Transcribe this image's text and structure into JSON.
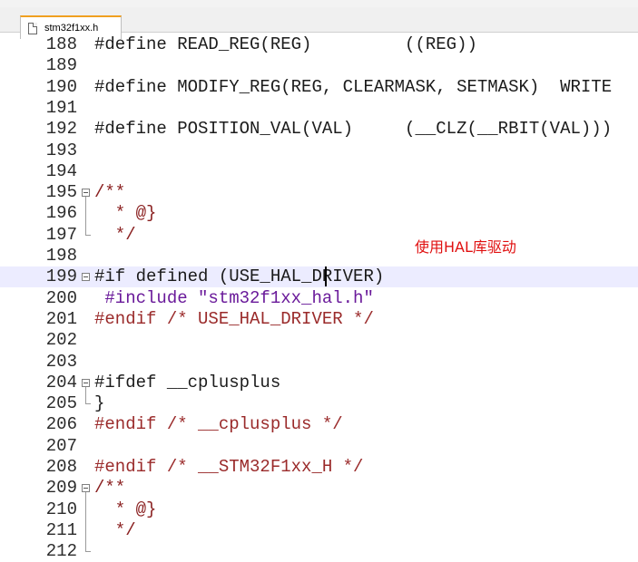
{
  "tab": {
    "filename": "stm32f1xx.h"
  },
  "annotation": "使用HAL库驱动",
  "lines": [
    {
      "num": "188",
      "text": "#define READ_REG(REG)         ((REG))"
    },
    {
      "num": "189",
      "text": ""
    },
    {
      "num": "190",
      "text": "#define MODIFY_REG(REG, CLEARMASK, SETMASK)  WRITE"
    },
    {
      "num": "191",
      "text": ""
    },
    {
      "num": "192",
      "text": "#define POSITION_VAL(VAL)     (__CLZ(__RBIT(VAL)))"
    },
    {
      "num": "193",
      "text": ""
    },
    {
      "num": "194",
      "text": ""
    },
    {
      "num": "195",
      "text": "/**"
    },
    {
      "num": "196",
      "text": "  * @}"
    },
    {
      "num": "197",
      "text": "  */"
    },
    {
      "num": "198",
      "text": ""
    },
    {
      "num": "199",
      "text": "#if defined (USE_HAL_DRIVER)"
    },
    {
      "num": "200",
      "text": " #include \"stm32f1xx_hal.h\""
    },
    {
      "num": "201",
      "text": "#endif /* USE_HAL_DRIVER */"
    },
    {
      "num": "202",
      "text": ""
    },
    {
      "num": "203",
      "text": ""
    },
    {
      "num": "204",
      "text": "#ifdef __cplusplus"
    },
    {
      "num": "205",
      "text": "}"
    },
    {
      "num": "206",
      "text": "#endif /* __cplusplus */"
    },
    {
      "num": "207",
      "text": ""
    },
    {
      "num": "208",
      "text": "#endif /* __STM32F1xx_H */"
    },
    {
      "num": "209",
      "text": "/**"
    },
    {
      "num": "210",
      "text": "  * @}"
    },
    {
      "num": "211",
      "text": "  */"
    },
    {
      "num": "212",
      "text": ""
    }
  ]
}
